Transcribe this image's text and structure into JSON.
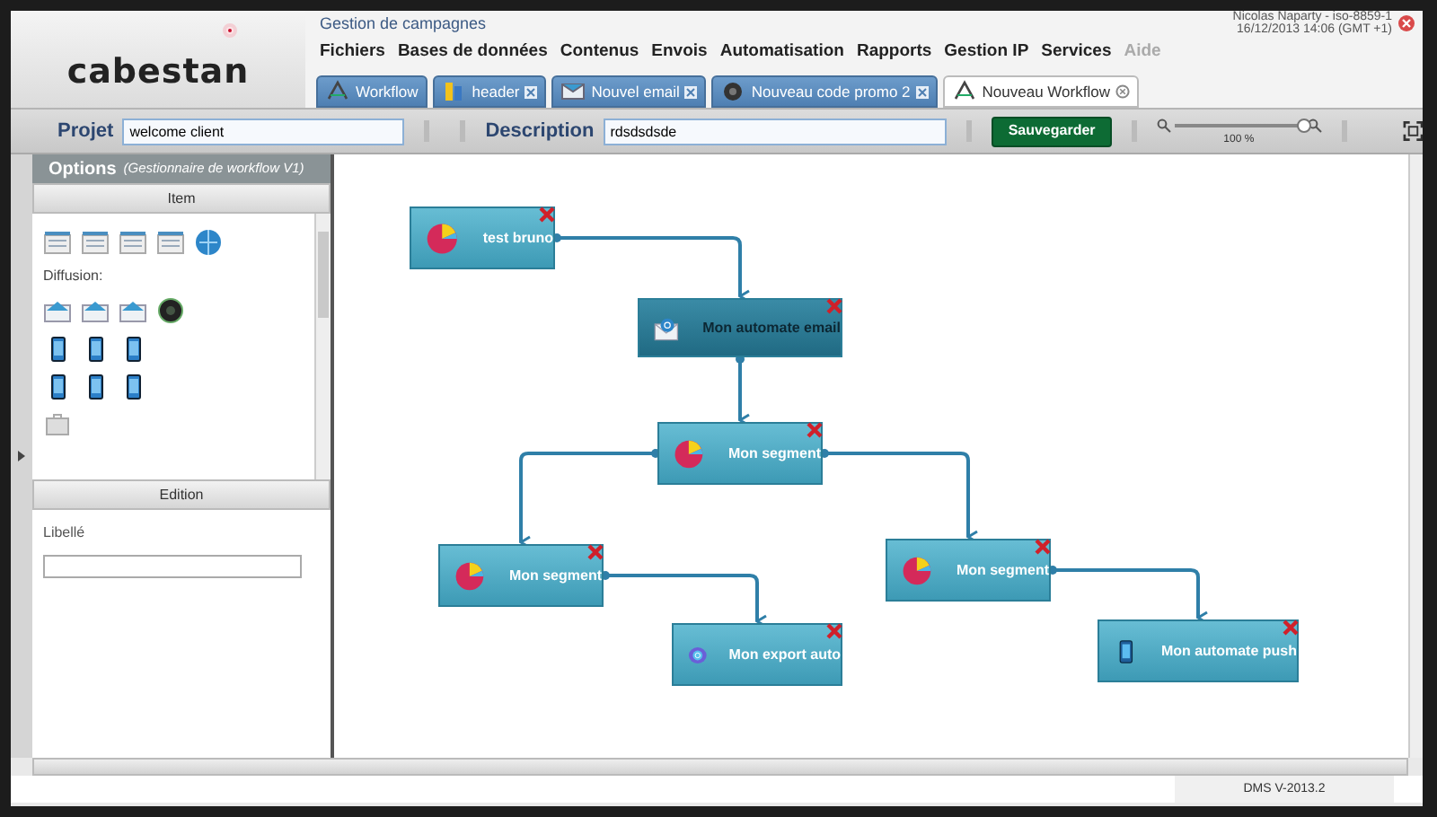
{
  "header": {
    "logo": "cabestan",
    "breadcrumb": "Gestion de campagnes",
    "user": "Nicolas Naparty - iso-8859-1",
    "datetime": "16/12/2013 14:06 (GMT +1)"
  },
  "menu": [
    {
      "label": "Fichiers",
      "disabled": false
    },
    {
      "label": "Bases de données",
      "disabled": false
    },
    {
      "label": "Contenus",
      "disabled": false
    },
    {
      "label": "Envois",
      "disabled": false
    },
    {
      "label": "Automatisation",
      "disabled": false
    },
    {
      "label": "Rapports",
      "disabled": false
    },
    {
      "label": "Gestion IP",
      "disabled": false
    },
    {
      "label": "Services",
      "disabled": false
    },
    {
      "label": "Aide",
      "disabled": true
    }
  ],
  "tabs": [
    {
      "label": "Workflow",
      "kind": "workflow",
      "closable": false,
      "selected": false
    },
    {
      "label": "header",
      "kind": "content",
      "closable": true,
      "selected": false
    },
    {
      "label": "Nouvel email",
      "kind": "email",
      "closable": true,
      "selected": false
    },
    {
      "label": "Nouveau code promo 2",
      "kind": "promo",
      "closable": true,
      "selected": false
    },
    {
      "label": "Nouveau Workflow",
      "kind": "workflow",
      "closable": true,
      "selected": true
    }
  ],
  "toolbar": {
    "project_label": "Projet",
    "project_value": "welcome client",
    "description_label": "Description",
    "description_value": "rdsdsdsde",
    "save_button": "Sauvegarder",
    "zoom": {
      "level": 1,
      "reading": "100 %"
    }
  },
  "options_panel": {
    "title": "Options",
    "subtitle": "(Gestionnaire de workflow V1)",
    "item_section": {
      "title": "Item",
      "group_label": "Diffusion:"
    },
    "edition_section": {
      "title": "Edition",
      "field_label": "Libellé"
    }
  },
  "workflow": {
    "nodes": [
      {
        "label": "test bruno",
        "kind": "segment",
        "selected": false,
        "children": [
          {
            "label": "Mon automate email",
            "kind": "email",
            "selected": true,
            "children": [
              {
                "label": "Mon segment",
                "kind": "segment",
                "selected": false,
                "children": [
                  {
                    "label": "Mon segment",
                    "kind": "segment",
                    "selected": false,
                    "children": [
                      {
                        "label": "Mon export auto",
                        "kind": "export",
                        "selected": false
                      }
                    ]
                  },
                  {
                    "label": "Mon segment",
                    "kind": "segment",
                    "selected": false,
                    "children": [
                      {
                        "label": "Mon automate push",
                        "kind": "push",
                        "selected": false
                      }
                    ]
                  }
                ]
              }
            ]
          }
        ]
      }
    ]
  },
  "footer": {
    "version": "DMS V-2013.2"
  }
}
